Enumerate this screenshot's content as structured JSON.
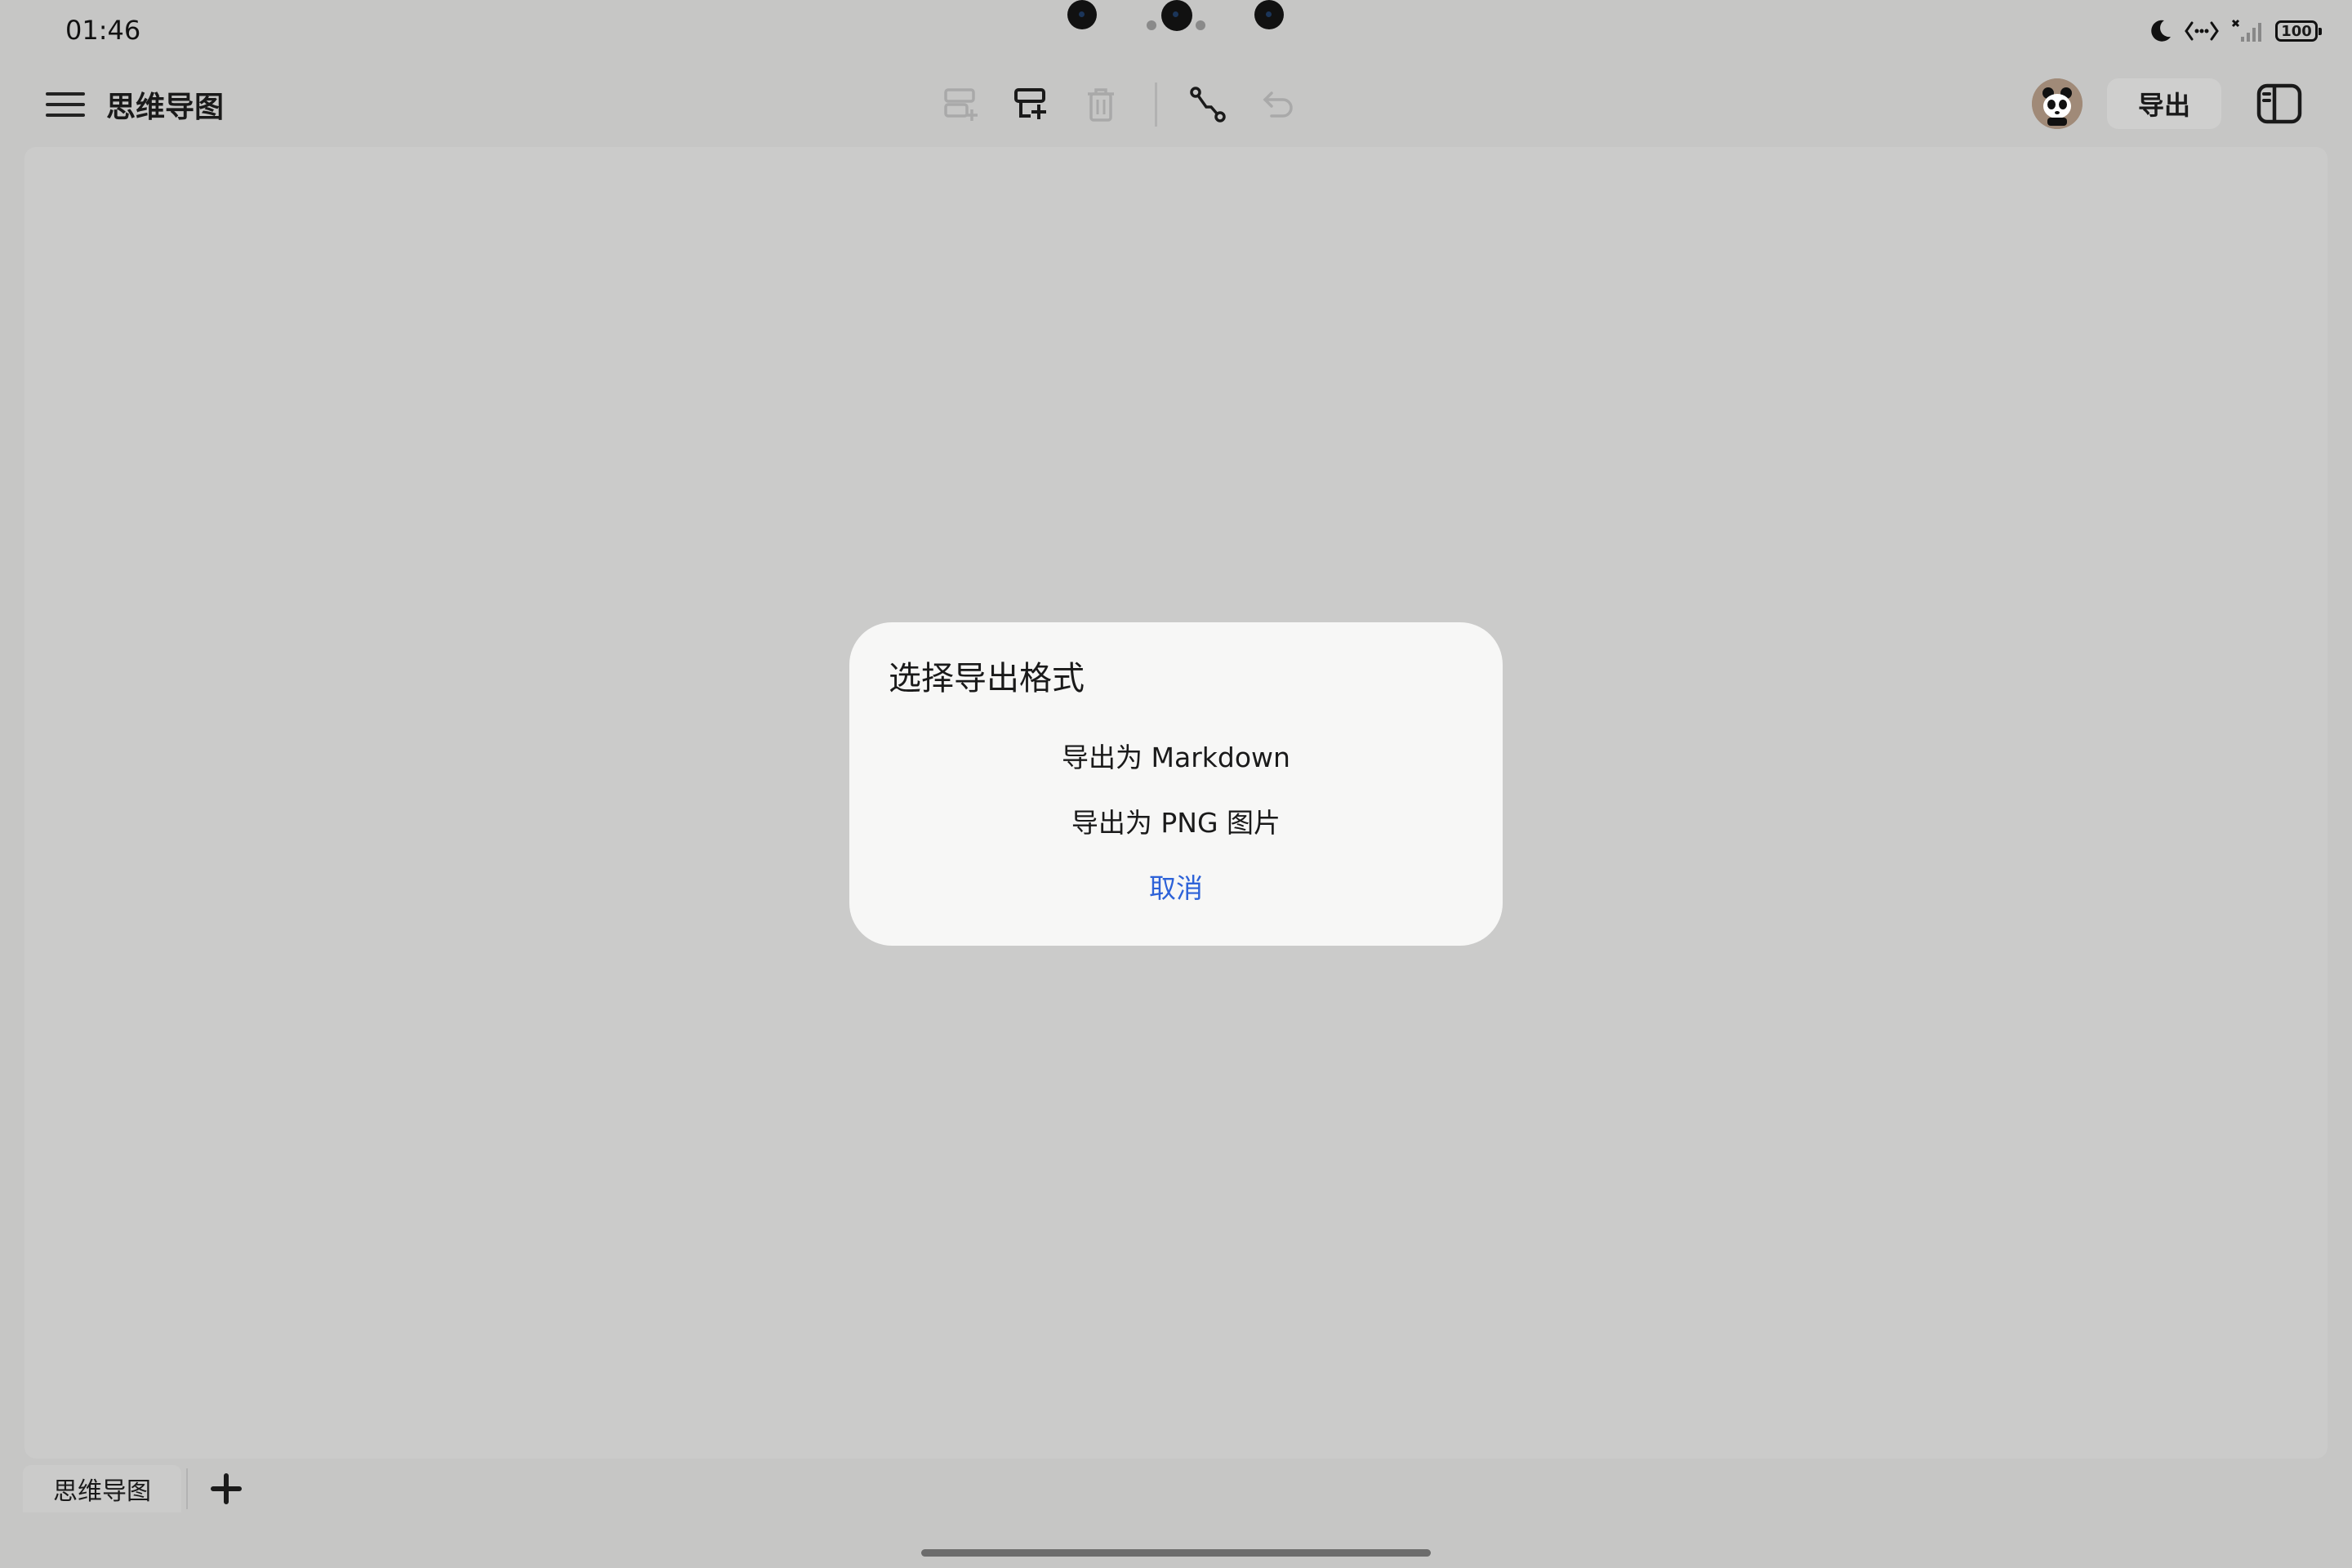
{
  "status_bar": {
    "time": "01:46",
    "battery_level": "100"
  },
  "app_bar": {
    "title": "思维导图",
    "export_label": "导出"
  },
  "toolbar": {
    "icons": [
      "add-sibling-node-icon",
      "add-child-node-icon",
      "delete-icon",
      "connector-icon",
      "undo-icon"
    ]
  },
  "dialog": {
    "title": "选择导出格式",
    "options": [
      {
        "label": "导出为 Markdown"
      },
      {
        "label": "导出为 PNG 图片"
      }
    ],
    "cancel_label": "取消"
  },
  "tabs": [
    {
      "label": "思维导图"
    }
  ],
  "colors": {
    "accent": "#2d62d8",
    "background": "#c6c6c5",
    "dialog_background": "#f7f7f6"
  }
}
